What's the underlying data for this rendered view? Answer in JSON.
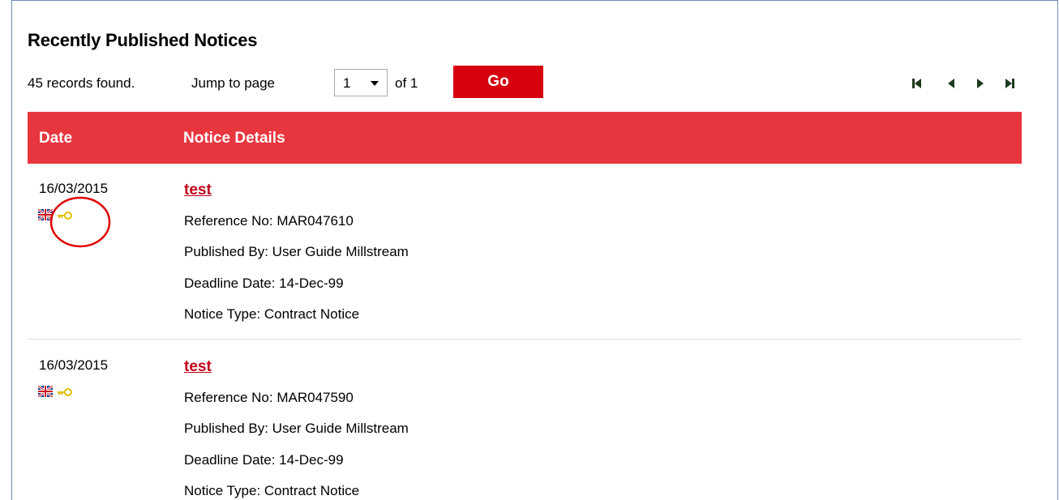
{
  "page": {
    "title": "Recently Published Notices"
  },
  "toolbar": {
    "records_text": "45 records found.",
    "jump_text": "Jump to page",
    "page_select_value": "1",
    "of_text": "of 1",
    "go_label": "Go"
  },
  "table": {
    "headers": [
      "Date",
      "Notice Details"
    ],
    "rows": [
      {
        "date": "16/03/2015",
        "title": "test",
        "reference": "Reference No: MAR047610",
        "published_by": "Published By: User Guide Millstream",
        "deadline": "Deadline Date: 14-Dec-99",
        "notice_type": "Notice Type: Contract Notice"
      },
      {
        "date": "16/03/2015",
        "title": "test",
        "reference": "Reference No: MAR047590",
        "published_by": "Published By: User Guide Millstream",
        "deadline": "Deadline Date: 14-Dec-99",
        "notice_type": "Notice Type: Contract Notice"
      }
    ]
  },
  "icons": {
    "flag": "uk-flag-icon",
    "key": "key-icon",
    "pager": [
      "first-page-icon",
      "previous-page-icon",
      "next-page-icon",
      "last-page-icon"
    ]
  },
  "colors": {
    "accent": "#e8363f",
    "button": "#d6000f",
    "link": "#c0001a",
    "annotation": "#e00000"
  }
}
